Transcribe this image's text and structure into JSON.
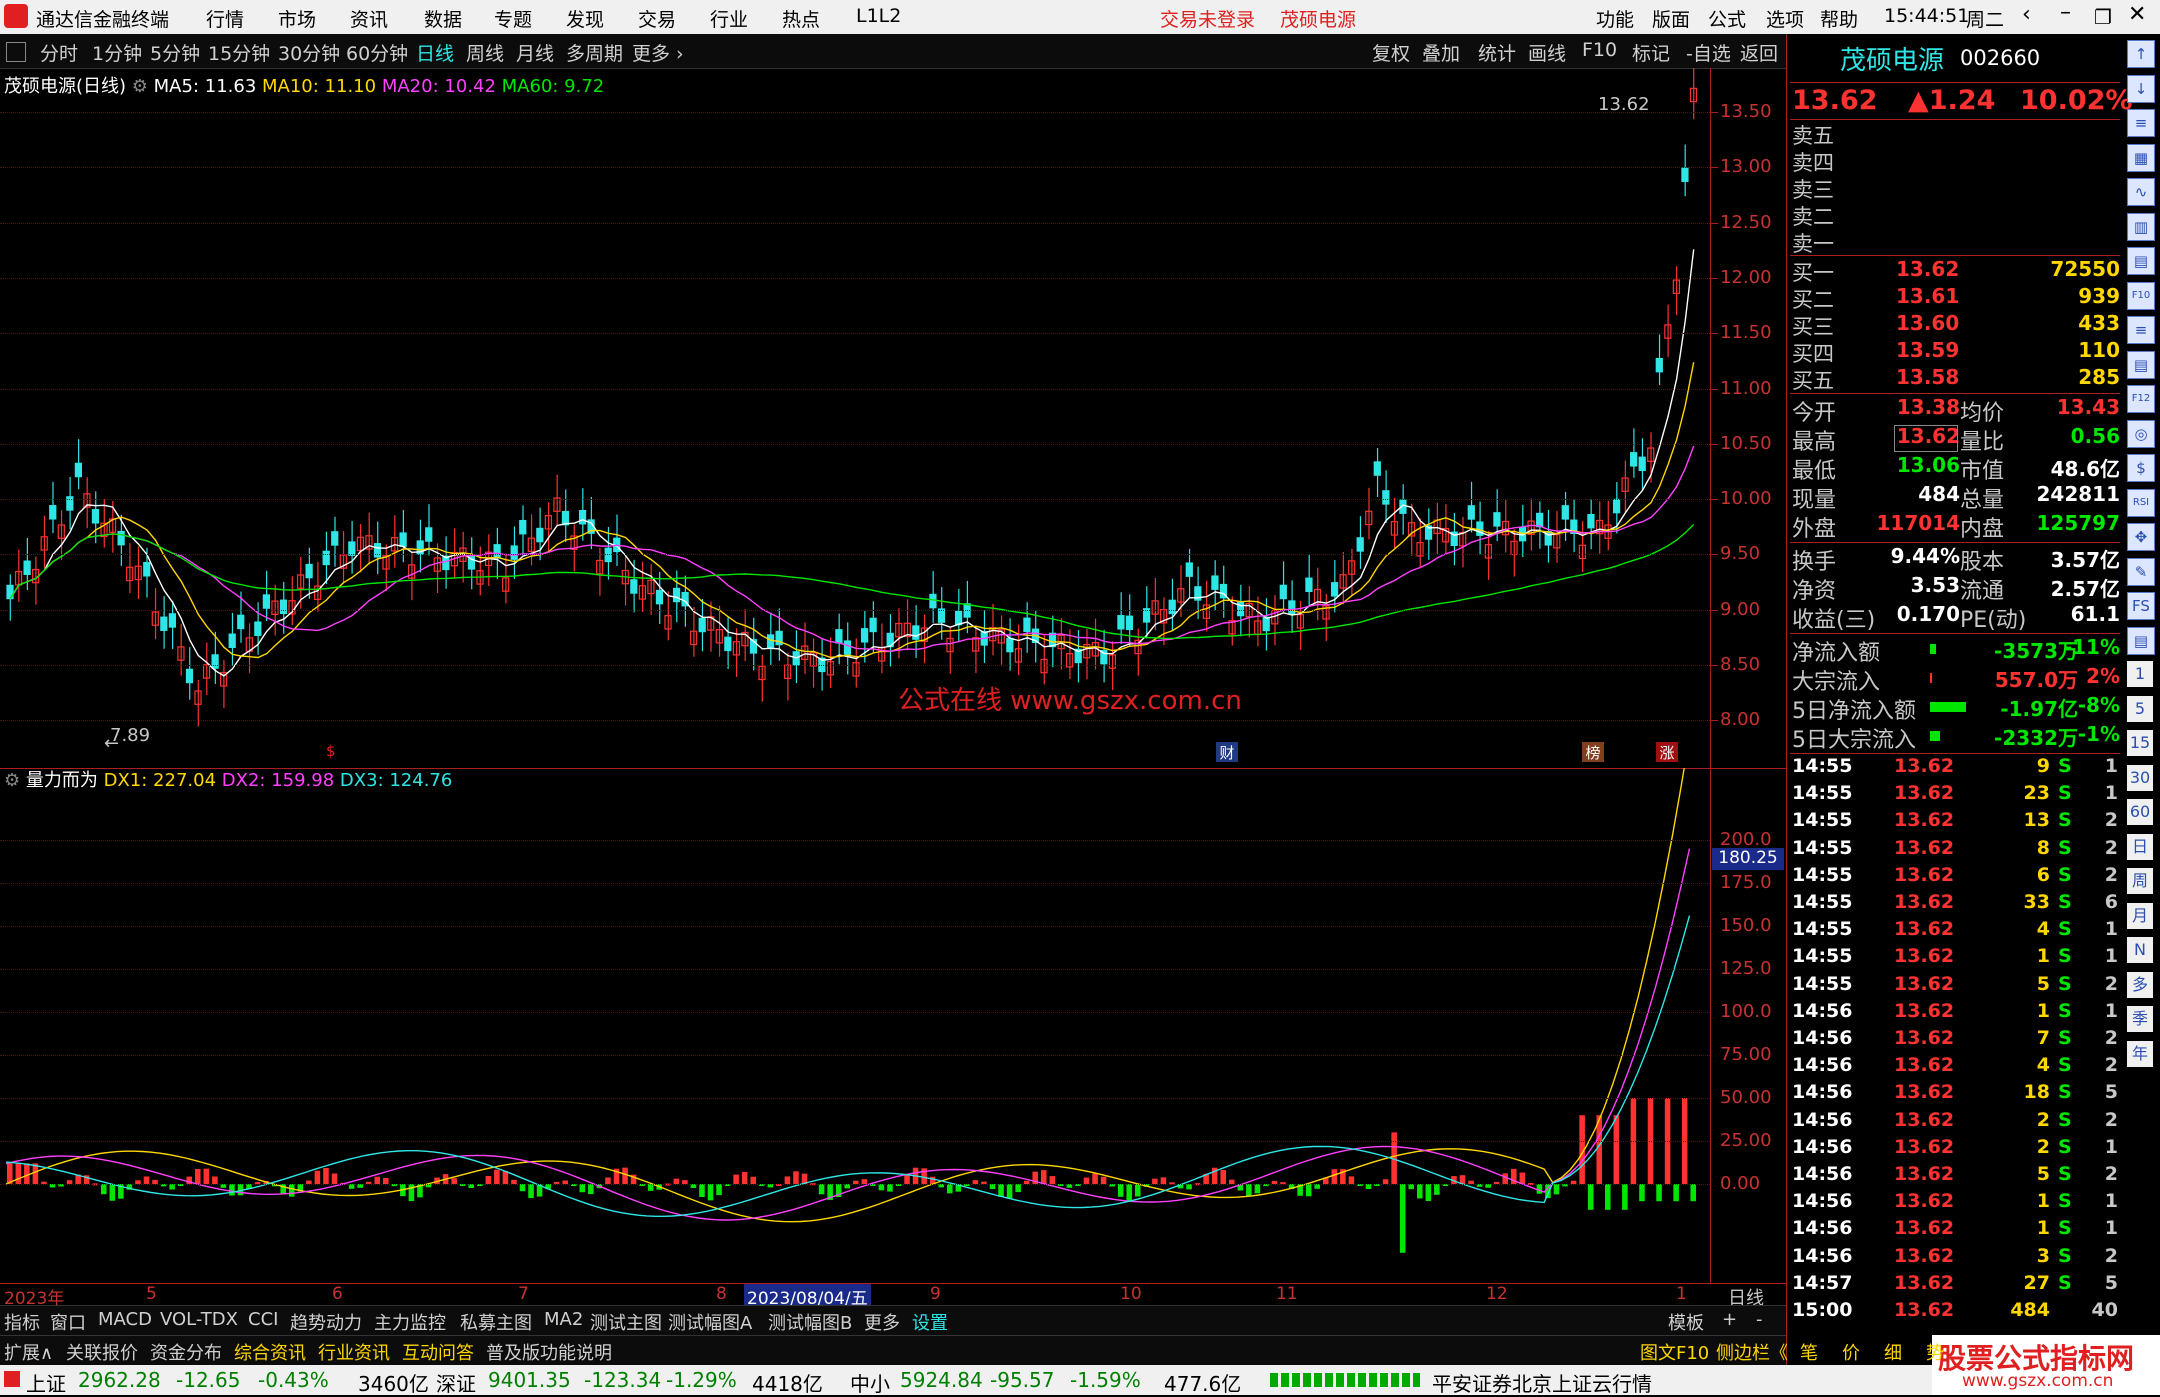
{
  "titlebar": {
    "app_name": "通达信金融终端",
    "menu": [
      "行情",
      "市场",
      "资讯",
      "数据",
      "专题",
      "发现",
      "交易",
      "行业",
      "热点",
      "L1L2"
    ],
    "trade_status": "交易未登录",
    "stock_name": "茂硕电源",
    "right_menu": [
      "功能",
      "版面",
      "公式",
      "选项",
      "帮助"
    ],
    "time": "15:44:51",
    "weekday": "周二"
  },
  "periods": [
    "分时",
    "1分钟",
    "5分钟",
    "15分钟",
    "30分钟",
    "60分钟",
    "日线",
    "周线",
    "月线",
    "多周期",
    "更多"
  ],
  "active_period": "日线",
  "tools": [
    "复权",
    "叠加",
    "统计",
    "画线",
    "F10",
    "标记",
    "-自选",
    "返回"
  ],
  "main_chart": {
    "title": "茂硕电源(日线)",
    "ma5": "MA5: 11.63",
    "ma10": "MA10: 11.10",
    "ma20": "MA20: 10.42",
    "ma60": "MA60: 9.72",
    "high_label": "13.62",
    "low_label": "7.89",
    "watermark": "公式在线  www.gszx.com.cn",
    "y_ticks": [
      "13.50",
      "13.00",
      "12.50",
      "12.00",
      "11.50",
      "11.00",
      "10.50",
      "10.00",
      "9.50",
      "9.00",
      "8.50",
      "8.00"
    ],
    "markers": [
      "$",
      "财",
      "榜",
      "涨"
    ]
  },
  "sub_chart": {
    "title": "量力而为",
    "dx1": "DX1: 227.04",
    "dx2": "DX2: 159.98",
    "dx3": "DX3: 124.76",
    "cursor_value": "180.25",
    "y_ticks": [
      "200.0",
      "175.0",
      "150.0",
      "125.0",
      "100.0",
      "75.00",
      "50.00",
      "25.00",
      "0.00"
    ]
  },
  "x_axis": {
    "labels": [
      "2023年",
      "5",
      "6",
      "7",
      "8",
      "9",
      "10",
      "11",
      "12",
      "1"
    ],
    "highlight_date": "2023/08/04/五",
    "period": "日线"
  },
  "tabs_row1": [
    "指标",
    "窗口",
    "MACD",
    "VOL-TDX",
    "CCI",
    "趋势动力",
    "主力监控",
    "私募主图",
    "MA2",
    "测试主图",
    "测试幅图A",
    "测试幅图B",
    "更多",
    "设置"
  ],
  "tabs_row1_right": [
    "模板",
    "+",
    "-"
  ],
  "tabs_row2": [
    "扩展∧",
    "关联报价",
    "资金分布",
    "综合资讯",
    "行业资讯",
    "互动问答",
    "普及版功能说明"
  ],
  "tabs_row2_right": [
    "图文F10",
    "侧边栏《",
    "笔",
    "价",
    "细",
    "势"
  ],
  "quote": {
    "name": "茂硕电源",
    "code": "002660",
    "price": "13.62",
    "change": "▲1.24",
    "pct": "10.02%",
    "sells": [
      "卖五",
      "卖四",
      "卖三",
      "卖二",
      "卖一"
    ],
    "buys": [
      {
        "label": "买一",
        "price": "13.62",
        "vol": "72550"
      },
      {
        "label": "买二",
        "price": "13.61",
        "vol": "939"
      },
      {
        "label": "买三",
        "price": "13.60",
        "vol": "433"
      },
      {
        "label": "买四",
        "price": "13.59",
        "vol": "110"
      },
      {
        "label": "买五",
        "price": "13.58",
        "vol": "285"
      }
    ],
    "stats": [
      {
        "l1": "今开",
        "v1": "13.38",
        "l2": "均价",
        "v2": "13.43"
      },
      {
        "l1": "最高",
        "v1": "13.62",
        "l2": "量比",
        "v2": "0.56"
      },
      {
        "l1": "最低",
        "v1": "13.06",
        "l2": "市值",
        "v2": "48.6亿"
      },
      {
        "l1": "现量",
        "v1": "484",
        "l2": "总量",
        "v2": "242811"
      },
      {
        "l1": "外盘",
        "v1": "117014",
        "l2": "内盘",
        "v2": "125797"
      }
    ],
    "stats2": [
      {
        "l1": "换手",
        "v1": "9.44%",
        "l2": "股本",
        "v2": "3.57亿"
      },
      {
        "l1": "净资",
        "v1": "3.53",
        "l2": "流通",
        "v2": "2.57亿"
      },
      {
        "l1": "收益(三)",
        "v1": "0.170",
        "l2": "PE(动)",
        "v2": "61.1"
      }
    ],
    "flows": [
      {
        "label": "净流入额",
        "value": "-3573万",
        "pct": "-11%"
      },
      {
        "label": "大宗流入",
        "value": "557.0万",
        "pct": "2%"
      },
      {
        "label": "5日净流入额",
        "value": "-1.97亿",
        "pct": "-8%"
      },
      {
        "label": "5日大宗流入",
        "value": "-2332万",
        "pct": "-1%"
      }
    ]
  },
  "ticks": [
    {
      "t": "14:55",
      "p": "13.62",
      "v": "9",
      "s": "S",
      "n": "1"
    },
    {
      "t": "14:55",
      "p": "13.62",
      "v": "23",
      "s": "S",
      "n": "1"
    },
    {
      "t": "14:55",
      "p": "13.62",
      "v": "13",
      "s": "S",
      "n": "2"
    },
    {
      "t": "14:55",
      "p": "13.62",
      "v": "8",
      "s": "S",
      "n": "2"
    },
    {
      "t": "14:55",
      "p": "13.62",
      "v": "6",
      "s": "S",
      "n": "2"
    },
    {
      "t": "14:55",
      "p": "13.62",
      "v": "33",
      "s": "S",
      "n": "6"
    },
    {
      "t": "14:55",
      "p": "13.62",
      "v": "4",
      "s": "S",
      "n": "1"
    },
    {
      "t": "14:55",
      "p": "13.62",
      "v": "1",
      "s": "S",
      "n": "1"
    },
    {
      "t": "14:55",
      "p": "13.62",
      "v": "5",
      "s": "S",
      "n": "2"
    },
    {
      "t": "14:56",
      "p": "13.62",
      "v": "1",
      "s": "S",
      "n": "1"
    },
    {
      "t": "14:56",
      "p": "13.62",
      "v": "7",
      "s": "S",
      "n": "2"
    },
    {
      "t": "14:56",
      "p": "13.62",
      "v": "4",
      "s": "S",
      "n": "2"
    },
    {
      "t": "14:56",
      "p": "13.62",
      "v": "18",
      "s": "S",
      "n": "5"
    },
    {
      "t": "14:56",
      "p": "13.62",
      "v": "2",
      "s": "S",
      "n": "2"
    },
    {
      "t": "14:56",
      "p": "13.62",
      "v": "2",
      "s": "S",
      "n": "1"
    },
    {
      "t": "14:56",
      "p": "13.62",
      "v": "5",
      "s": "S",
      "n": "2"
    },
    {
      "t": "14:56",
      "p": "13.62",
      "v": "1",
      "s": "S",
      "n": "1"
    },
    {
      "t": "14:56",
      "p": "13.62",
      "v": "1",
      "s": "S",
      "n": "1"
    },
    {
      "t": "14:56",
      "p": "13.62",
      "v": "3",
      "s": "S",
      "n": "2"
    },
    {
      "t": "14:57",
      "p": "13.62",
      "v": "27",
      "s": "S",
      "n": "5"
    },
    {
      "t": "15:00",
      "p": "13.62",
      "v": "484",
      "s": "",
      "n": "40"
    }
  ],
  "side_icons": [
    "↑",
    "↓",
    "≡",
    "▦",
    "∿",
    "▥",
    "▤",
    "F10",
    "≡",
    "▤",
    "F12",
    "◎",
    "$",
    "RSI",
    "✥",
    "✎",
    "FS",
    "▤",
    "1",
    "5",
    "15",
    "30",
    "60",
    "日",
    "周",
    "月",
    "N",
    "多",
    "季",
    "年"
  ],
  "status": {
    "sh_label": "上证",
    "sh": "2962.28",
    "sh_chg": "-12.65",
    "sh_pct": "-0.43%",
    "sh_amt": "3460亿",
    "sz_label": "深证",
    "sz": "9401.35",
    "sz_chg": "-123.34",
    "sz_pct": "-1.29%",
    "sz_amt": "4418亿",
    "zx_label": "中小",
    "zx": "5924.84",
    "zx_chg": "-95.57",
    "zx_pct": "-1.59%",
    "zx_amt": "477.6亿",
    "server": "平安证券北京上证云行情",
    "site_logo": "股票公式指标网",
    "site_url": "www.gszx.com.cn"
  }
}
